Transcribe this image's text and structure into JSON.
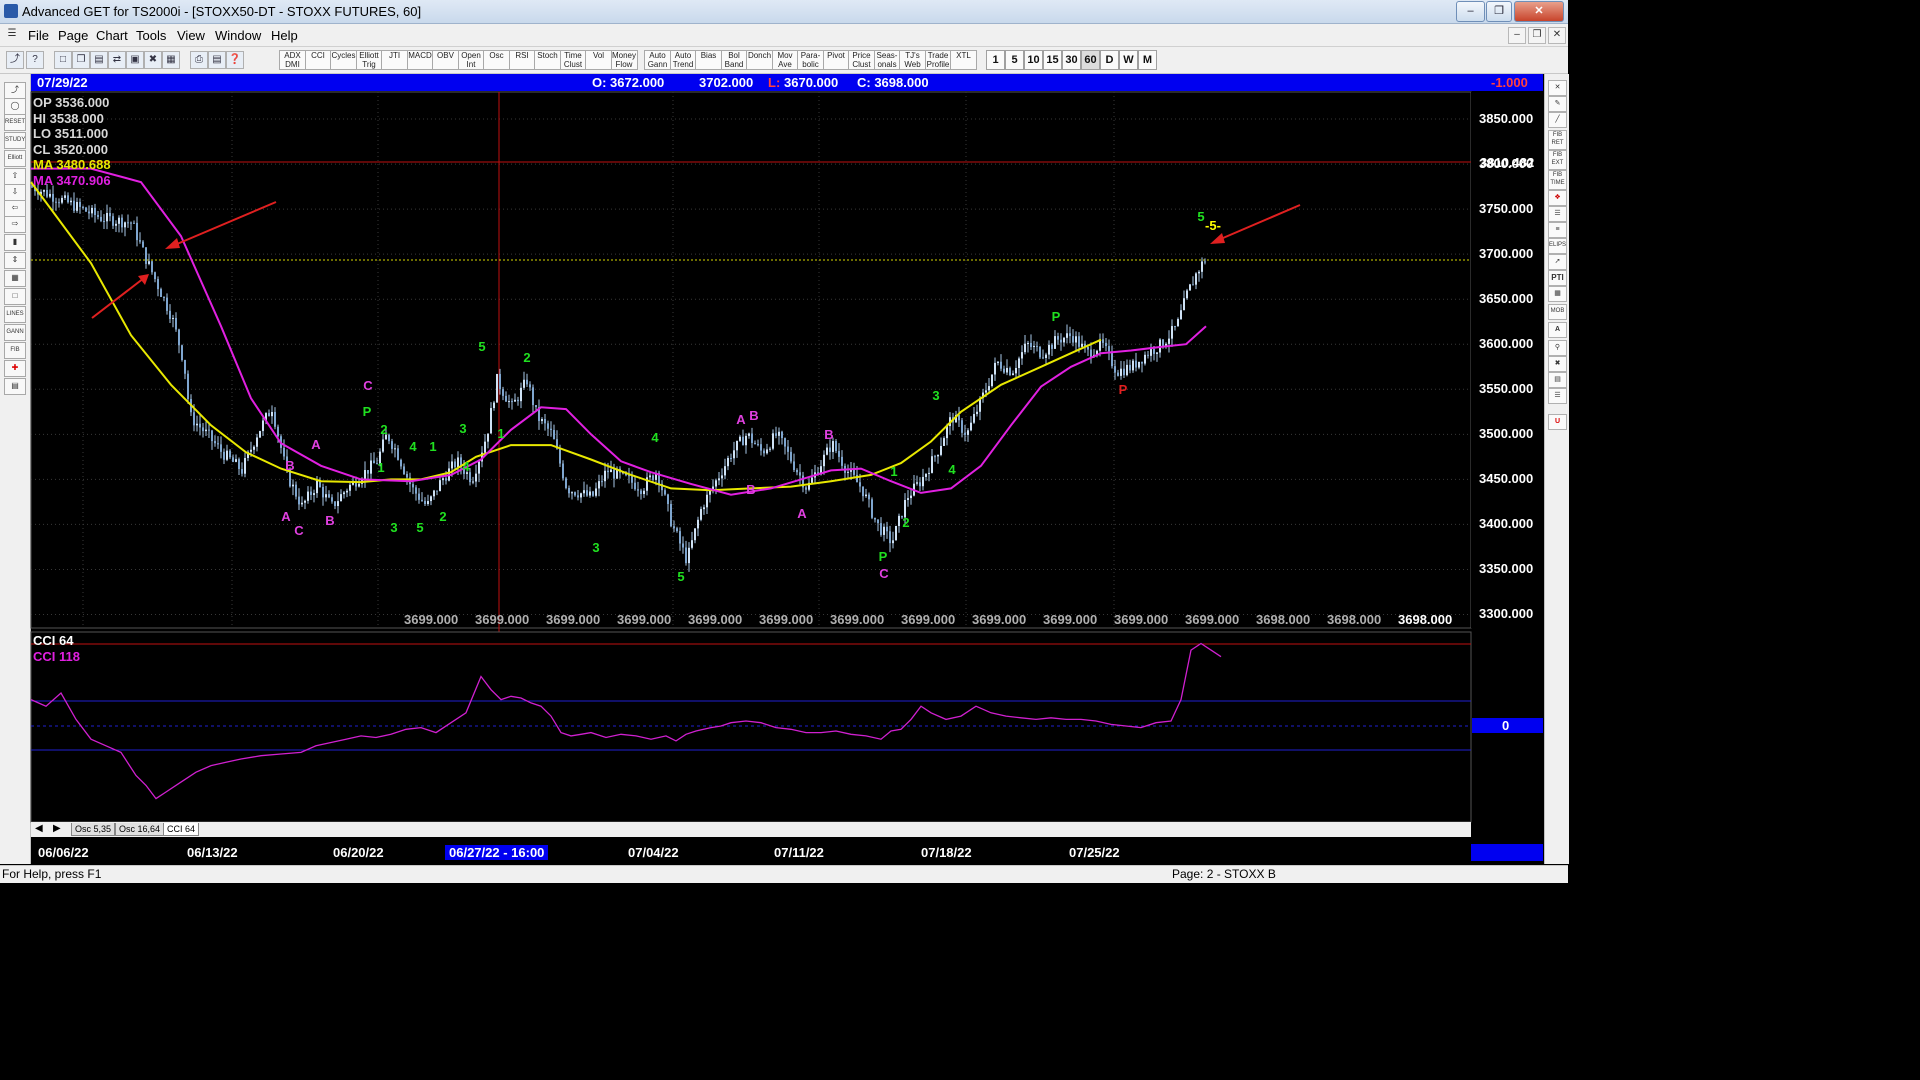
{
  "window": {
    "title": "Advanced GET for TS2000i - [STOXX50-DT - STOXX FUTURES, 60]",
    "minimize": "–",
    "restore": "❐",
    "close": "✕"
  },
  "menu": [
    "File",
    "Page",
    "Chart",
    "Tools",
    "View",
    "Window",
    "Help"
  ],
  "toolbar": {
    "indicators": [
      "ADX DMI",
      "CCI",
      "Cycles",
      "Elliott Trig",
      "JTI",
      "MACD",
      "OBV",
      "Open Int",
      "Osc",
      "RSI",
      "Stoch",
      "Time Clust",
      "Vol",
      "Money Flow",
      "Auto Gann",
      "Auto Trend",
      "Bias",
      "Bol Band",
      "Donch",
      "Mov Ave",
      "Para-bolic",
      "Pivot",
      "Price Clust",
      "Seas-onals",
      "TJ's Web",
      "Trade Profile",
      "XTL"
    ],
    "timeframes": [
      "1",
      "5",
      "10",
      "15",
      "30",
      "60",
      "D",
      "W",
      "M"
    ]
  },
  "left_tools": [
    "RESET",
    "STUDY",
    "Elliott",
    "LINES",
    "GANN",
    "FIB"
  ],
  "right_tools": [
    "FIB RET",
    "FIB EXT",
    "FIB TIME",
    "ELIPS",
    "PTI",
    "MOB"
  ],
  "infobar": {
    "date": "07/29/22",
    "open": "O: 3672.000",
    "high": "3702.000",
    "low_label": "L:",
    "low": "3670.000",
    "close": "C: 3698.000",
    "change": "-1.000"
  },
  "ohlc": {
    "op": "OP  3536.000",
    "hi": "HI   3538.000",
    "lo": "LO  3511.000",
    "cl": "CL   3520.000",
    "ma1": "MA  3480.688",
    "ma2": "MA  3470.906"
  },
  "price_axis": [
    "3850.000",
    "3800.000",
    "3750.000",
    "3700.000",
    "3650.000",
    "3600.000",
    "3550.000",
    "3500.000",
    "3450.000",
    "3400.000",
    "3350.000",
    "3300.000"
  ],
  "price_marker": "3810.482",
  "bottom_prices": [
    "3699.000",
    "3699.000",
    "3699.000",
    "3699.000",
    "3699.000",
    "3699.000",
    "3699.000",
    "3699.000",
    "3699.000",
    "3699.000",
    "3699.000",
    "3699.000",
    "3698.000",
    "3698.000",
    "3698.000"
  ],
  "cci": {
    "label1": "CCI 64",
    "label2": "CCI  118",
    "zero": "0"
  },
  "tabs": [
    "Osc 5,35",
    "Osc 16,64",
    "CCI 64"
  ],
  "date_axis": [
    "06/06/22",
    "06/13/22",
    "06/20/22",
    "06/27/22 - 16:00",
    "07/04/22",
    "07/11/22",
    "07/18/22",
    "07/25/22"
  ],
  "status": {
    "left": "For Help, press F1",
    "right": "Page: 2 - STOXX B"
  },
  "annotations": [
    {
      "t": "A",
      "c": "#e040e0"
    },
    {
      "t": "B",
      "c": "#e040e0"
    },
    {
      "t": "C",
      "c": "#e040e0"
    },
    {
      "t": "B",
      "c": "#e040e0"
    },
    {
      "t": "A",
      "c": "#e040e0"
    },
    {
      "t": "C",
      "c": "#e040e0"
    },
    {
      "t": "P",
      "c": "#20e020"
    },
    {
      "t": "2",
      "c": "#20e020"
    },
    {
      "t": "1",
      "c": "#20e020"
    },
    {
      "t": "4",
      "c": "#20e020"
    },
    {
      "t": "1",
      "c": "#20e020"
    },
    {
      "t": "3",
      "c": "#20e020"
    },
    {
      "t": "3",
      "c": "#20e020"
    },
    {
      "t": "5",
      "c": "#20e020"
    },
    {
      "t": "2",
      "c": "#20e020"
    },
    {
      "t": "4",
      "c": "#20e020"
    },
    {
      "t": "5",
      "c": "#20e020"
    },
    {
      "t": "2",
      "c": "#20e020"
    },
    {
      "t": "1",
      "c": "#20e020"
    },
    {
      "t": "3",
      "c": "#20e020"
    },
    {
      "t": "4",
      "c": "#20e020"
    },
    {
      "t": "5",
      "c": "#20e020"
    },
    {
      "t": "A",
      "c": "#e040e0"
    },
    {
      "t": "B",
      "c": "#e040e0"
    },
    {
      "t": "B",
      "c": "#e040e0"
    },
    {
      "t": "B",
      "c": "#e040e0"
    },
    {
      "t": "A",
      "c": "#e040e0"
    },
    {
      "t": "1",
      "c": "#20e020"
    },
    {
      "t": "2",
      "c": "#20e020"
    },
    {
      "t": "P",
      "c": "#20e020"
    },
    {
      "t": "C",
      "c": "#e040e0"
    },
    {
      "t": "3",
      "c": "#20e020"
    },
    {
      "t": "4",
      "c": "#20e020"
    },
    {
      "t": "P",
      "c": "#20e020"
    },
    {
      "t": "P",
      "c": "#e02020"
    },
    {
      "t": "5",
      "c": "#20e020"
    },
    {
      "t": "-5-",
      "c": "#ffff00"
    }
  ],
  "chart_data": {
    "type": "candlestick",
    "ylim": [
      3285,
      3880
    ],
    "ma_yellow": [
      [
        0,
        3780
      ],
      [
        20,
        3750
      ],
      [
        60,
        3690
      ],
      [
        100,
        3610
      ],
      [
        140,
        3555
      ],
      [
        180,
        3510
      ],
      [
        215,
        3480
      ],
      [
        250,
        3462
      ],
      [
        290,
        3448
      ],
      [
        330,
        3447
      ],
      [
        360,
        3450
      ],
      [
        390,
        3450
      ],
      [
        420,
        3458
      ],
      [
        445,
        3475
      ],
      [
        480,
        3488
      ],
      [
        520,
        3488
      ],
      [
        560,
        3472
      ],
      [
        600,
        3455
      ],
      [
        640,
        3440
      ],
      [
        680,
        3438
      ],
      [
        720,
        3440
      ],
      [
        760,
        3442
      ],
      [
        800,
        3448
      ],
      [
        840,
        3455
      ],
      [
        870,
        3468
      ],
      [
        900,
        3492
      ],
      [
        930,
        3525
      ],
      [
        970,
        3555
      ],
      [
        1010,
        3575
      ],
      [
        1040,
        3590
      ],
      [
        1070,
        3605
      ]
    ],
    "ma_magenta": [
      [
        0,
        3795
      ],
      [
        60,
        3795
      ],
      [
        110,
        3780
      ],
      [
        150,
        3720
      ],
      [
        190,
        3620
      ],
      [
        220,
        3540
      ],
      [
        250,
        3490
      ],
      [
        290,
        3465
      ],
      [
        330,
        3450
      ],
      [
        380,
        3448
      ],
      [
        420,
        3455
      ],
      [
        450,
        3472
      ],
      [
        480,
        3505
      ],
      [
        510,
        3530
      ],
      [
        535,
        3528
      ],
      [
        560,
        3500
      ],
      [
        590,
        3470
      ],
      [
        620,
        3458
      ],
      [
        660,
        3445
      ],
      [
        700,
        3433
      ],
      [
        740,
        3440
      ],
      [
        770,
        3450
      ],
      [
        800,
        3460
      ],
      [
        830,
        3462
      ],
      [
        860,
        3448
      ],
      [
        890,
        3435
      ],
      [
        920,
        3440
      ],
      [
        950,
        3465
      ],
      [
        980,
        3510
      ],
      [
        1010,
        3553
      ],
      [
        1040,
        3575
      ],
      [
        1070,
        3590
      ],
      [
        1100,
        3593
      ],
      [
        1130,
        3597
      ],
      [
        1155,
        3600
      ],
      [
        1175,
        3620
      ]
    ],
    "closes": [
      [
        0,
        3775
      ],
      [
        30,
        3760
      ],
      [
        70,
        3740
      ],
      [
        100,
        3735
      ],
      [
        112,
        3700
      ],
      [
        120,
        3680
      ],
      [
        140,
        3630
      ],
      [
        152,
        3580
      ],
      [
        158,
        3520
      ],
      [
        175,
        3500
      ],
      [
        190,
        3480
      ],
      [
        210,
        3460
      ],
      [
        225,
        3500
      ],
      [
        240,
        3530
      ],
      [
        255,
        3455
      ],
      [
        270,
        3420
      ],
      [
        285,
        3445
      ],
      [
        300,
        3420
      ],
      [
        315,
        3440
      ],
      [
        330,
        3455
      ],
      [
        345,
        3470
      ],
      [
        355,
        3500
      ],
      [
        365,
        3480
      ],
      [
        380,
        3440
      ],
      [
        395,
        3420
      ],
      [
        410,
        3450
      ],
      [
        425,
        3470
      ],
      [
        440,
        3450
      ],
      [
        455,
        3500
      ],
      [
        465,
        3560
      ],
      [
        480,
        3530
      ],
      [
        495,
        3560
      ],
      [
        505,
        3520
      ],
      [
        520,
        3500
      ],
      [
        535,
        3440
      ],
      [
        560,
        3430
      ],
      [
        575,
        3460
      ],
      [
        595,
        3450
      ],
      [
        610,
        3440
      ],
      [
        625,
        3460
      ],
      [
        640,
        3400
      ],
      [
        655,
        3360
      ],
      [
        670,
        3420
      ],
      [
        685,
        3450
      ],
      [
        700,
        3480
      ],
      [
        715,
        3500
      ],
      [
        730,
        3480
      ],
      [
        745,
        3500
      ],
      [
        760,
        3470
      ],
      [
        775,
        3440
      ],
      [
        790,
        3470
      ],
      [
        800,
        3490
      ],
      [
        815,
        3460
      ],
      [
        830,
        3440
      ],
      [
        845,
        3400
      ],
      [
        860,
        3380
      ],
      [
        875,
        3430
      ],
      [
        890,
        3450
      ],
      [
        905,
        3480
      ],
      [
        920,
        3520
      ],
      [
        935,
        3500
      ],
      [
        950,
        3540
      ],
      [
        965,
        3580
      ],
      [
        980,
        3570
      ],
      [
        995,
        3600
      ],
      [
        1010,
        3590
      ],
      [
        1025,
        3605
      ],
      [
        1040,
        3610
      ],
      [
        1055,
        3590
      ],
      [
        1070,
        3600
      ],
      [
        1085,
        3570
      ],
      [
        1100,
        3575
      ],
      [
        1115,
        3590
      ],
      [
        1130,
        3600
      ],
      [
        1145,
        3620
      ],
      [
        1155,
        3655
      ],
      [
        1165,
        3680
      ],
      [
        1175,
        3698
      ]
    ],
    "cci": [
      [
        0,
        80
      ],
      [
        15,
        60
      ],
      [
        30,
        100
      ],
      [
        45,
        20
      ],
      [
        60,
        -40
      ],
      [
        75,
        -60
      ],
      [
        90,
        -80
      ],
      [
        105,
        -150
      ],
      [
        115,
        -180
      ],
      [
        125,
        -220
      ],
      [
        135,
        -200
      ],
      [
        150,
        -170
      ],
      [
        165,
        -140
      ],
      [
        180,
        -120
      ],
      [
        195,
        -110
      ],
      [
        210,
        -100
      ],
      [
        230,
        -90
      ],
      [
        250,
        -85
      ],
      [
        270,
        -80
      ],
      [
        285,
        -60
      ],
      [
        300,
        -50
      ],
      [
        315,
        -40
      ],
      [
        330,
        -30
      ],
      [
        345,
        -35
      ],
      [
        360,
        -25
      ],
      [
        375,
        -10
      ],
      [
        390,
        -5
      ],
      [
        405,
        -20
      ],
      [
        420,
        10
      ],
      [
        435,
        40
      ],
      [
        450,
        150
      ],
      [
        460,
        110
      ],
      [
        470,
        80
      ],
      [
        480,
        90
      ],
      [
        490,
        85
      ],
      [
        500,
        70
      ],
      [
        510,
        60
      ],
      [
        520,
        30
      ],
      [
        530,
        -20
      ],
      [
        540,
        -30
      ],
      [
        550,
        -25
      ],
      [
        560,
        -20
      ],
      [
        575,
        -35
      ],
      [
        590,
        -25
      ],
      [
        605,
        -30
      ],
      [
        620,
        -40
      ],
      [
        635,
        -30
      ],
      [
        645,
        -45
      ],
      [
        655,
        -25
      ],
      [
        665,
        -15
      ],
      [
        680,
        -5
      ],
      [
        690,
        0
      ],
      [
        700,
        10
      ],
      [
        715,
        15
      ],
      [
        730,
        10
      ],
      [
        745,
        -5
      ],
      [
        760,
        -10
      ],
      [
        775,
        -20
      ],
      [
        790,
        -20
      ],
      [
        805,
        -15
      ],
      [
        820,
        -25
      ],
      [
        835,
        -30
      ],
      [
        850,
        -40
      ],
      [
        860,
        -15
      ],
      [
        870,
        -10
      ],
      [
        880,
        20
      ],
      [
        890,
        60
      ],
      [
        900,
        40
      ],
      [
        915,
        20
      ],
      [
        930,
        30
      ],
      [
        945,
        60
      ],
      [
        960,
        40
      ],
      [
        975,
        30
      ],
      [
        990,
        25
      ],
      [
        1005,
        20
      ],
      [
        1020,
        25
      ],
      [
        1035,
        20
      ],
      [
        1050,
        20
      ],
      [
        1065,
        15
      ],
      [
        1080,
        5
      ],
      [
        1095,
        0
      ],
      [
        1110,
        -5
      ],
      [
        1125,
        10
      ],
      [
        1140,
        15
      ],
      [
        1150,
        80
      ],
      [
        1160,
        230
      ],
      [
        1170,
        250
      ],
      [
        1180,
        230
      ],
      [
        1190,
        210
      ]
    ]
  }
}
